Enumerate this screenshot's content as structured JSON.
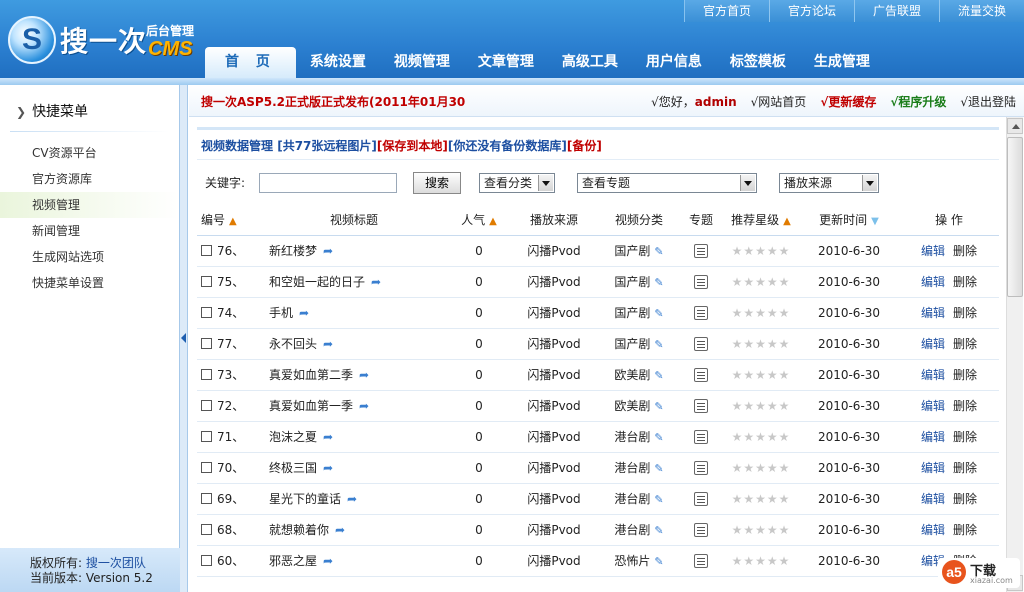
{
  "header": {
    "logo_icon": "S",
    "logo_text": "搜一次",
    "logo_sub": "后台管理",
    "logo_cms": "CMS",
    "top_links": [
      "官方首页",
      "官方论坛",
      "广告联盟",
      "流量交换"
    ],
    "nav_tabs": [
      "首 页",
      "系统设置",
      "视频管理",
      "文章管理",
      "高级工具",
      "用户信息",
      "标签模板",
      "生成管理"
    ],
    "active_tab_index": 0
  },
  "sidebar": {
    "title": "快捷菜单",
    "items": [
      "CV资源平台",
      "官方资源库",
      "视频管理",
      "新闻管理",
      "生成网站选项",
      "快捷菜单设置"
    ],
    "active_index": 2,
    "footer_copyright_label": "版权所有:",
    "footer_copyright_value": "搜一次团队",
    "footer_version": "当前版本: Version 5.2"
  },
  "notice": {
    "text": "搜一次ASP5.2正式版正式发布(2011年01月30",
    "hello_label": "√您好，",
    "user": "admin",
    "site_home": "√网站首页",
    "refresh_cache": "√更新缓存",
    "upgrade": "√程序升级",
    "logout": "√退出登陆"
  },
  "panel": {
    "crumb_title": "视频数据管理",
    "crumb_remote": "[共77张远程图片]",
    "crumb_save": "[保存到本地]",
    "crumb_nobackup": "[你还没有备份数据库]",
    "crumb_backup": "[备份]"
  },
  "search": {
    "keyword_label": "关键字:",
    "keyword_value": "",
    "button_label": "搜索",
    "category_select": "查看分类",
    "topic_select": "查看专题",
    "source_select": "播放来源"
  },
  "table": {
    "headers": [
      "编号",
      "视频标题",
      "人气",
      "播放来源",
      "视频分类",
      "专题",
      "推荐星级",
      "更新时间",
      "操 作"
    ],
    "edit_label": "编辑",
    "delete_label": "删除",
    "rows": [
      {
        "id": "76、",
        "title": "新红楼梦",
        "hits": "0",
        "source": "闪播Pvod",
        "category": "国产剧",
        "stars": "★★★★★",
        "date": "2010-6-30"
      },
      {
        "id": "75、",
        "title": "和空姐一起的日子",
        "hits": "0",
        "source": "闪播Pvod",
        "category": "国产剧",
        "stars": "★★★★★",
        "date": "2010-6-30"
      },
      {
        "id": "74、",
        "title": "手机",
        "hits": "0",
        "source": "闪播Pvod",
        "category": "国产剧",
        "stars": "★★★★★",
        "date": "2010-6-30"
      },
      {
        "id": "77、",
        "title": "永不回头",
        "hits": "0",
        "source": "闪播Pvod",
        "category": "国产剧",
        "stars": "★★★★★",
        "date": "2010-6-30"
      },
      {
        "id": "73、",
        "title": "真爱如血第二季",
        "hits": "0",
        "source": "闪播Pvod",
        "category": "欧美剧",
        "stars": "★★★★★",
        "date": "2010-6-30"
      },
      {
        "id": "72、",
        "title": "真爱如血第一季",
        "hits": "0",
        "source": "闪播Pvod",
        "category": "欧美剧",
        "stars": "★★★★★",
        "date": "2010-6-30"
      },
      {
        "id": "71、",
        "title": "泡沫之夏",
        "hits": "0",
        "source": "闪播Pvod",
        "category": "港台剧",
        "stars": "★★★★★",
        "date": "2010-6-30"
      },
      {
        "id": "70、",
        "title": "终极三国",
        "hits": "0",
        "source": "闪播Pvod",
        "category": "港台剧",
        "stars": "★★★★★",
        "date": "2010-6-30"
      },
      {
        "id": "69、",
        "title": "星光下的童话",
        "hits": "0",
        "source": "闪播Pvod",
        "category": "港台剧",
        "stars": "★★★★★",
        "date": "2010-6-30"
      },
      {
        "id": "68、",
        "title": "就想赖着你",
        "hits": "0",
        "source": "闪播Pvod",
        "category": "港台剧",
        "stars": "★★★★★",
        "date": "2010-6-30"
      },
      {
        "id": "60、",
        "title": "邪恶之屋",
        "hits": "0",
        "source": "闪播Pvod",
        "category": "恐怖片",
        "stars": "★★★★★",
        "date": "2010-6-30"
      }
    ]
  },
  "watermark": {
    "badge": "a5",
    "text": "下载",
    "site": "xiazai.com"
  }
}
